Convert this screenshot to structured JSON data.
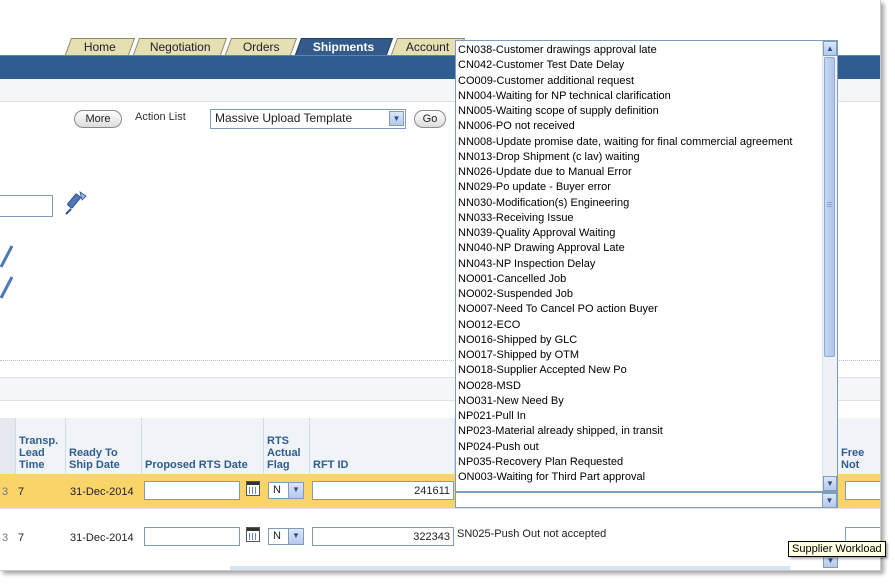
{
  "tabs": [
    {
      "label": "Home",
      "active": false
    },
    {
      "label": "Negotiation",
      "active": false
    },
    {
      "label": "Orders",
      "active": false
    },
    {
      "label": "Shipments",
      "active": true
    },
    {
      "label": "Account",
      "active": false
    }
  ],
  "toolbar": {
    "more_label": "More",
    "action_list_label": "Action List",
    "action_list_value": "Massive Upload Template",
    "go_label": "Go"
  },
  "table": {
    "headers": {
      "transp_lead_time": [
        "Transp.",
        "Lead",
        "Time"
      ],
      "ready_to_ship_date": [
        "Ready To",
        "Ship Date"
      ],
      "proposed_rts_date": "Proposed RTS Date",
      "rts_actual_flag": [
        "RTS",
        "Actual",
        "Flag"
      ],
      "rft_id": "RFT ID",
      "free_note": "Free Not"
    },
    "rows": [
      {
        "prefix": "3",
        "lead_time": "7",
        "ready_to_ship": "31-Dec-2014",
        "proposed_rts": "",
        "flag": "N",
        "rft_id": "241611",
        "reason": "ON003-Waiting for Third Part approval"
      },
      {
        "prefix": "3",
        "lead_time": "7",
        "ready_to_ship": "31-Dec-2014",
        "proposed_rts": "",
        "flag": "N",
        "rft_id": "322343",
        "reason": "SN025-Push Out not accepted"
      }
    ]
  },
  "dropdown": {
    "options": [
      "CN038-Customer drawings approval late",
      "CN042-Customer Test Date Delay",
      "CO009-Customer additional request",
      "NN004-Waiting for NP technical clarification",
      "NN005-Waiting scope of supply definition",
      "NN006-PO not received",
      "NN008-Update promise date, waiting for final commercial agreement",
      "NN013-Drop Shipment (c lav) waiting",
      "NN026-Update due to Manual Error",
      "NN029-Po update - Buyer error",
      "NN030-Modification(s) Engineering",
      "NN033-Receiving Issue",
      "NN039-Quality Approval Waiting",
      "NN040-NP Drawing Approval Late",
      "NN043-NP Inspection Delay",
      "NO001-Cancelled Job",
      "NO002-Suspended Job",
      "NO007-Need To Cancel PO action Buyer",
      "NO012-ECO",
      "NO016-Shipped by GLC",
      "NO017-Shipped by OTM",
      "NO018-Supplier Accepted New Po",
      "NO028-MSD",
      "NO031-New Need By",
      "NP021-Pull In",
      "NP023-Material already shipped, in transit",
      "NP024-Push out",
      "NP035-Recovery Plan Requested",
      "ON003-Waiting for Third Part approval"
    ]
  },
  "tooltip": "Supplier Workload",
  "colors": {
    "nav_blue": "#2f5d91",
    "tab_tan": "#e6dfb4",
    "highlight_row": "#f9d468"
  }
}
